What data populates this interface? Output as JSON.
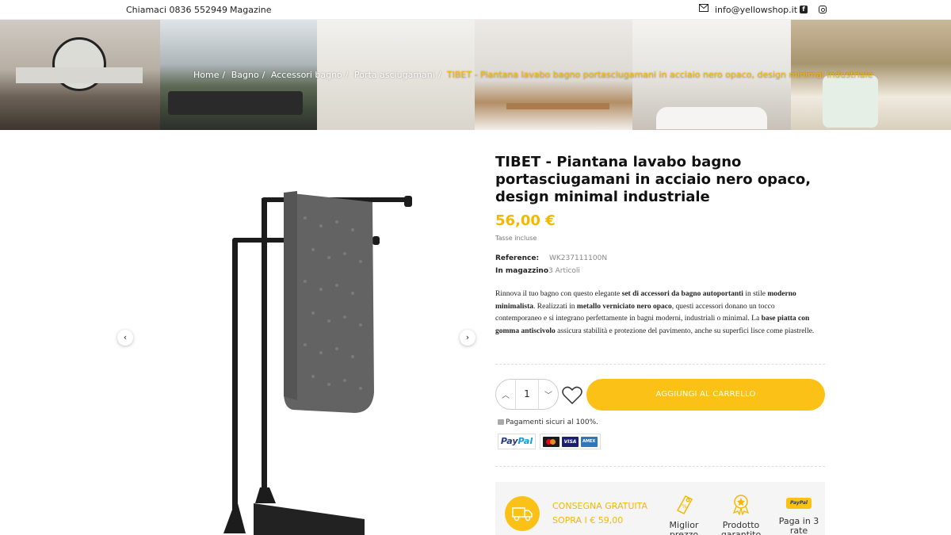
{
  "topbar": {
    "phone": "Chiamaci 0836 552949",
    "magazine": "Magazine",
    "email": "info@yellowshop.it"
  },
  "breadcrumb": {
    "items": [
      "Home",
      "Bagno",
      "Accessori bagno",
      "Porta asciugamani"
    ],
    "current": "TIBET - Piantana lavabo bagno portasciugamani in acciaio nero opaco, design minimal industriale"
  },
  "product": {
    "title": "TIBET - Piantana lavabo bagno portasciugamani in acciaio nero opaco, design minimal industriale",
    "price": "56,00 €",
    "tax_note": "Tasse incluse",
    "reference_label": "Reference:",
    "reference_value": "WK237111100N",
    "stock_label": "In magazzino",
    "stock_value": "3 Articoli",
    "description": {
      "t1": "Rinnova il tuo bagno con questo elegante ",
      "b1": "set di accessori da bagno autoportanti",
      "t2": " in stile ",
      "b2": "moderno minimalista",
      "t3": ". Realizzati in ",
      "b3": "metallo verniciato nero opaco",
      "t4": ", questi accessori donano un tocco contemporaneo e si integrano perfettamente in bagni moderni, industriali o minimal. La ",
      "b4": "base piatta con gomma antiscivolo",
      "t5": " assicura stabilità e protezione del pavimento, anche su superfici lisce come piastrelle."
    }
  },
  "purchase": {
    "quantity": "1",
    "add_to_cart": "AGGIUNGI AL CARRELLO",
    "secure_payments": "Pagamenti sicuri al 100%.",
    "paypal_a": "Pay",
    "paypal_b": "Pal",
    "cards": [
      "",
      "VISA",
      "AMERICAN EXPRESS"
    ]
  },
  "shipping": {
    "line1": "CONSEGNA GRATUITA",
    "line2": "SOPRA I € 59,00"
  },
  "features": [
    {
      "label": "Miglior prezzo",
      "icon": "price-tag-icon"
    },
    {
      "label": "Prodotto garantito",
      "icon": "award-badge-icon"
    },
    {
      "label": "Paga in 3 rate",
      "icon": "paypal-icon",
      "badge": "PayPal"
    }
  ],
  "colors": {
    "accent": "#fbc117",
    "price": "#f5b800"
  }
}
